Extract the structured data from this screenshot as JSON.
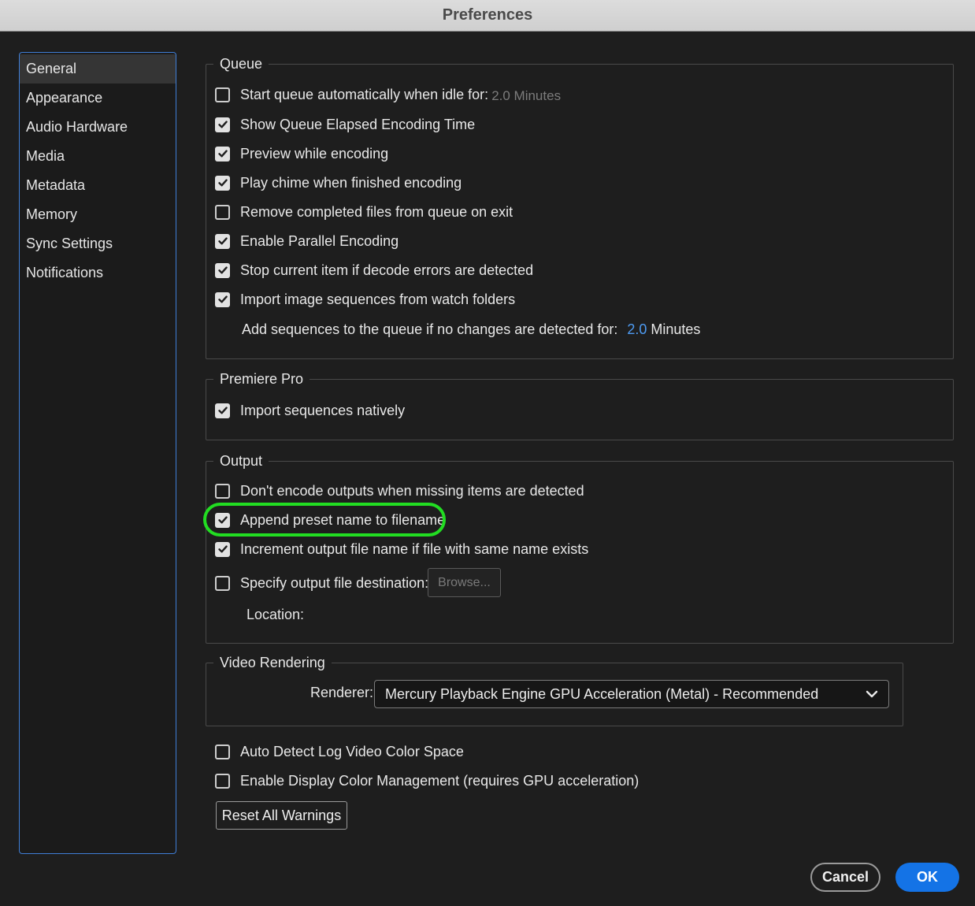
{
  "window": {
    "title": "Preferences"
  },
  "sidebar": {
    "items": [
      {
        "label": "General",
        "active": true
      },
      {
        "label": "Appearance"
      },
      {
        "label": "Audio Hardware"
      },
      {
        "label": "Media"
      },
      {
        "label": "Metadata"
      },
      {
        "label": "Memory"
      },
      {
        "label": "Sync Settings"
      },
      {
        "label": "Notifications"
      }
    ]
  },
  "queue": {
    "title": "Queue",
    "start_auto": {
      "label": "Start queue automatically when idle for:",
      "value": "2.0 Minutes",
      "checked": false
    },
    "elapsed": {
      "label": "Show Queue Elapsed Encoding Time",
      "checked": true
    },
    "preview": {
      "label": "Preview while encoding",
      "checked": true
    },
    "chime": {
      "label": "Play chime when finished encoding",
      "checked": true
    },
    "remove_completed": {
      "label": "Remove completed files from queue on exit",
      "checked": false
    },
    "parallel": {
      "label": "Enable Parallel Encoding",
      "checked": true
    },
    "stop_decode": {
      "label": "Stop current item if decode errors are detected",
      "checked": true
    },
    "import_seq": {
      "label": "Import image sequences from watch folders",
      "checked": true
    },
    "add_seq": {
      "label": "Add sequences to the queue if no changes are detected for:",
      "value": "2.0",
      "unit": "Minutes"
    }
  },
  "premiere": {
    "title": "Premiere Pro",
    "native": {
      "label": "Import sequences natively",
      "checked": true
    }
  },
  "output": {
    "title": "Output",
    "dont_encode": {
      "label": "Don't encode outputs when missing items are detected",
      "checked": false
    },
    "append_preset": {
      "label": "Append preset name to filename",
      "checked": true
    },
    "increment": {
      "label": "Increment output file name if file with same name exists",
      "checked": true
    },
    "specify_dest": {
      "label": "Specify output file destination:",
      "checked": false
    },
    "browse_label": "Browse...",
    "location_label": "Location:"
  },
  "video_rendering": {
    "title": "Video Rendering",
    "renderer_label": "Renderer:",
    "renderer_value": "Mercury Playback Engine GPU Acceleration (Metal) - Recommended"
  },
  "misc": {
    "auto_detect": {
      "label": "Auto Detect Log Video Color Space",
      "checked": false
    },
    "display_color": {
      "label": "Enable Display Color Management (requires GPU acceleration)",
      "checked": false
    },
    "reset_label": "Reset All Warnings"
  },
  "footer": {
    "cancel_label": "Cancel",
    "ok_label": "OK"
  },
  "colors": {
    "accent": "#1473e6",
    "highlight": "#22dd22",
    "value_blue": "#4e9bf2"
  }
}
